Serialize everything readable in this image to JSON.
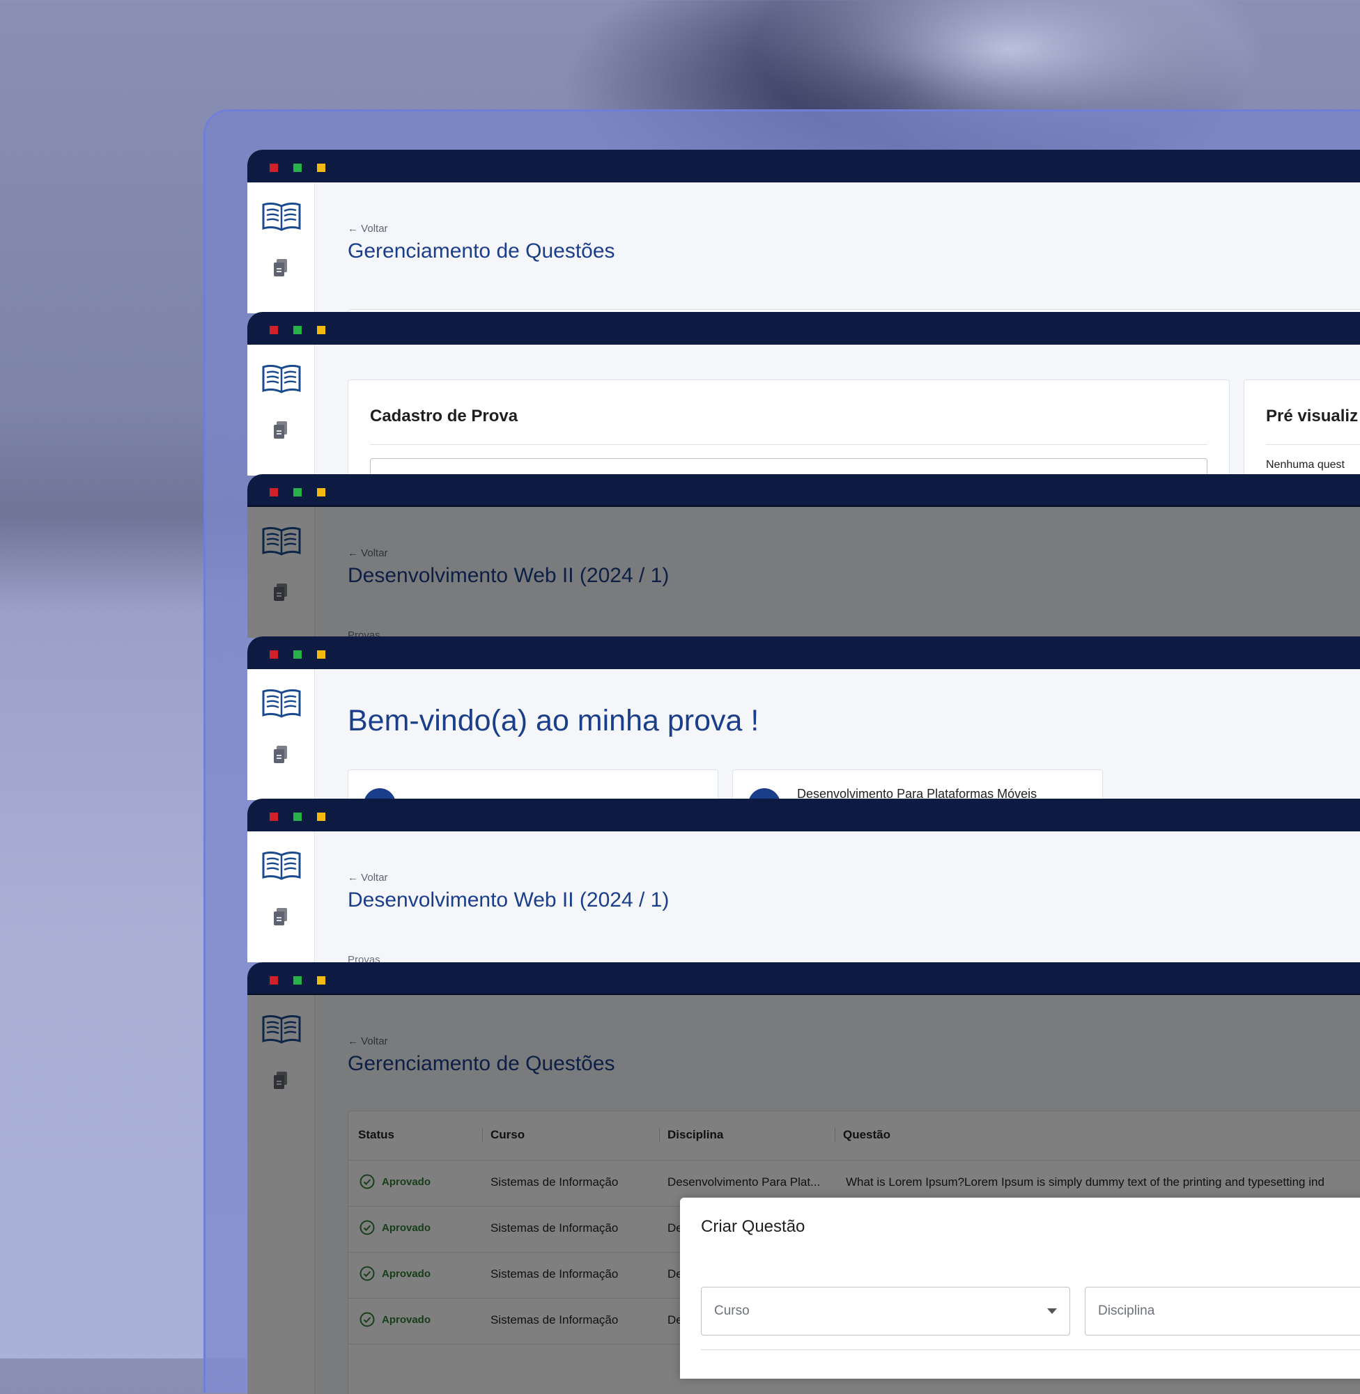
{
  "windows": [
    {
      "back": "Voltar",
      "title": "Gerenciamento de Questões"
    },
    {
      "card_title": "Cadastro de Prova",
      "preview_title": "Pré visualiz",
      "preview_empty": "Nenhuma quest"
    },
    {
      "back": "Voltar",
      "title": "Desenvolvimento Web II (2024 / 1)",
      "section": "Provas"
    },
    {
      "welcome": "Bem-vindo(a) ao minha prova !",
      "course_card_2": "Desenvolvimento Para Plataformas Móveis"
    },
    {
      "back": "Voltar",
      "title": "Desenvolvimento Web II (2024 / 1)",
      "section": "Provas"
    },
    {
      "back": "Voltar",
      "title": "Gerenciamento de Questões",
      "table": {
        "headers": [
          "Status",
          "Curso",
          "Disciplina",
          "Questão"
        ],
        "rows": [
          {
            "status": "Aprovado",
            "curso": "Sistemas de Informação",
            "disciplina": "Desenvolvimento Para Plat...",
            "questao": "What is Lorem Ipsum?Lorem Ipsum is simply dummy text of the printing and typesetting ind"
          },
          {
            "status": "Aprovado",
            "curso": "Sistemas de Informação",
            "disciplina": "De",
            "questao": ""
          },
          {
            "status": "Aprovado",
            "curso": "Sistemas de Informação",
            "disciplina": "De",
            "questao": ""
          },
          {
            "status": "Aprovado",
            "curso": "Sistemas de Informação",
            "disciplina": "De",
            "questao": ""
          }
        ]
      },
      "modal": {
        "title": "Criar Questão",
        "curso_placeholder": "Curso",
        "disciplina_placeholder": "Disciplina"
      }
    }
  ],
  "colors": {
    "titlebar": "#0d1b42",
    "accent": "#1b3e8a",
    "approved": "#2e7d32"
  }
}
